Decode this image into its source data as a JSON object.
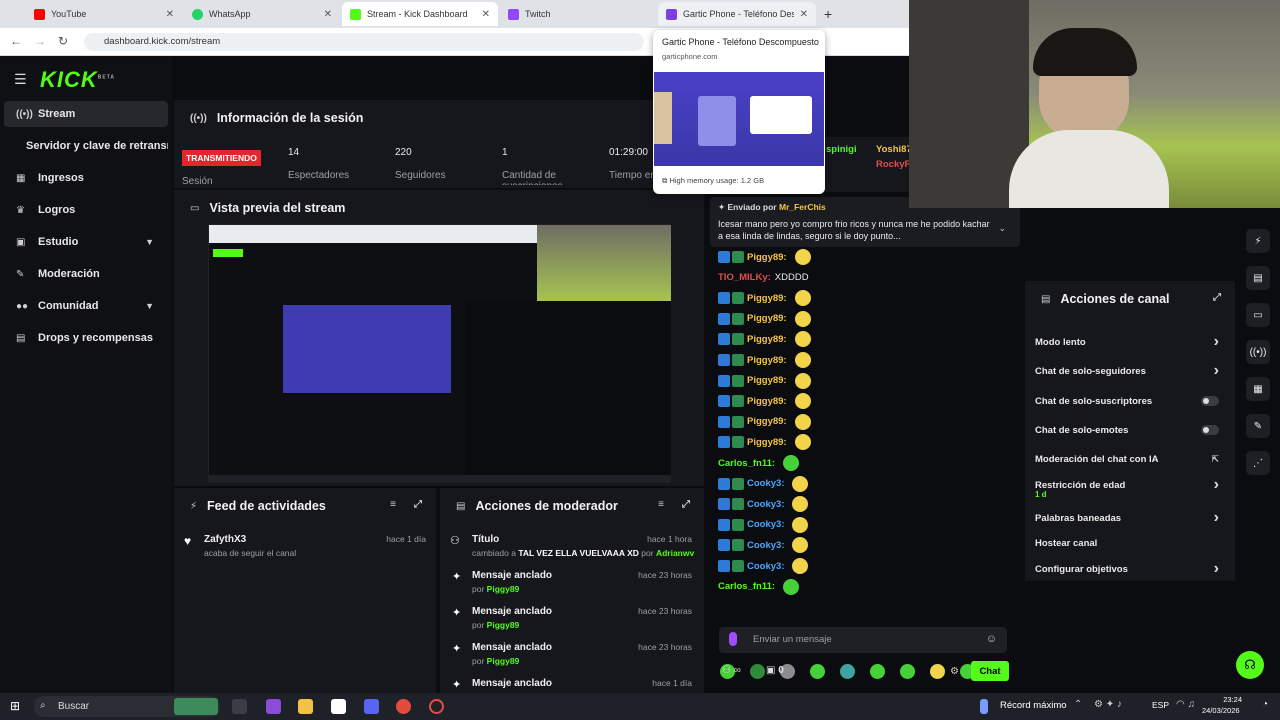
{
  "browser": {
    "tabs": [
      {
        "title": "YouTube",
        "color": "#ff0000"
      },
      {
        "title": "WhatsApp",
        "color": "#25d366"
      },
      {
        "title": "Stream - Kick Dashboard",
        "color": "#53fc18"
      },
      {
        "title": "Twitch",
        "color": "#9146ff"
      },
      {
        "title": "Gartic Phone - Teléfono Descon",
        "color": "#7b3fe4"
      }
    ],
    "url": "dashboard.kick.com/stream",
    "hover_card": {
      "title": "Gartic Phone - Teléfono Descompuesto",
      "domain": "garticphone.com",
      "memory": "High memory usage: 1.2 GB"
    }
  },
  "sidebar": {
    "logo": "KICK",
    "logo_sup": "BETA",
    "items": [
      {
        "label": "Stream",
        "icon": "broadcast-icon"
      },
      {
        "label": "Servidor y clave de retransmisión",
        "icon": ""
      },
      {
        "label": "Ingresos",
        "icon": "chart-icon"
      },
      {
        "label": "Logros",
        "icon": "trophy-icon"
      },
      {
        "label": "Estudio",
        "icon": "grid-icon"
      },
      {
        "label": "Moderación",
        "icon": "wrench-icon"
      },
      {
        "label": "Comunidad",
        "icon": "users-icon"
      },
      {
        "label": "Drops y recompensas",
        "icon": "gift-icon"
      }
    ]
  },
  "session": {
    "title": "Información de la sesión",
    "status_badge": "TRANSMITIENDO",
    "status_label": "Sesión",
    "stats": [
      {
        "value": "14",
        "label": "Espectadores"
      },
      {
        "value": "220",
        "label": "Seguidores"
      },
      {
        "value": "1",
        "label": "Cantidad de suscripciones"
      },
      {
        "value": "01:29:00",
        "label": "Tiempo en vivo"
      }
    ]
  },
  "preview": {
    "title": "Vista previa del stream"
  },
  "feed": {
    "title": "Feed de actividades",
    "items": [
      {
        "name": "ZafythX3",
        "action": "acaba de seguir el canal",
        "time": "hace 1 día"
      }
    ]
  },
  "mod_actions": {
    "title": "Acciones de moderador",
    "items": [
      {
        "title": "Título",
        "detail_prefix": "cambiado a",
        "detail": "TAL VEZ ELLA VUELVAAA XD",
        "by_prefix": "por",
        "by": "Adrianwv",
        "time": "hace 1 hora"
      },
      {
        "title": "Mensaje anclado",
        "detail_prefix": "por",
        "detail": "Piggy89",
        "time": "hace 23 horas"
      },
      {
        "title": "Mensaje anclado",
        "detail_prefix": "por",
        "detail": "Piggy89",
        "time": "hace 23 horas"
      },
      {
        "title": "Mensaje anclado",
        "detail_prefix": "por",
        "detail": "Piggy89",
        "time": "hace 23 horas"
      },
      {
        "title": "Mensaje anclado",
        "detail_prefix": "",
        "detail": "",
        "time": "hace 1 día"
      }
    ]
  },
  "chat": {
    "top_users": [
      "spinigi",
      "Yoshi87",
      "RockyF"
    ],
    "pinned": {
      "label": "Enviado por",
      "user": "Mr_FerChis",
      "text": "Icesar mano pero yo compro frio ricos y nunca me he podido kachar a esa linda de lindas, seguro si le doy punto..."
    },
    "messages": [
      {
        "user": "Piggy89:",
        "text": "",
        "color": "#f5c542",
        "emote": "y"
      },
      {
        "user": "TIO_MILKy:",
        "text": "XDDDD",
        "color": "#e24d4d",
        "emote": ""
      },
      {
        "user": "Piggy89:",
        "text": "",
        "color": "#f5c542",
        "emote": "y"
      },
      {
        "user": "Piggy89:",
        "text": "",
        "color": "#f5c542",
        "emote": "y"
      },
      {
        "user": "Piggy89:",
        "text": "",
        "color": "#f5c542",
        "emote": "y"
      },
      {
        "user": "Piggy89:",
        "text": "",
        "color": "#f5c542",
        "emote": "y"
      },
      {
        "user": "Piggy89:",
        "text": "",
        "color": "#f5c542",
        "emote": "y"
      },
      {
        "user": "Piggy89:",
        "text": "",
        "color": "#f5c542",
        "emote": "y"
      },
      {
        "user": "Piggy89:",
        "text": "",
        "color": "#f5c542",
        "emote": "y"
      },
      {
        "user": "Piggy89:",
        "text": "",
        "color": "#f5c542",
        "emote": "y"
      },
      {
        "user": "Carlos_fn11:",
        "text": "",
        "color": "#53fc18",
        "emote": "g"
      },
      {
        "user": "Cooky3:",
        "text": "",
        "color": "#4aa8ff",
        "emote": "y"
      },
      {
        "user": "Cooky3:",
        "text": "",
        "color": "#4aa8ff",
        "emote": "y"
      },
      {
        "user": "Cooky3:",
        "text": "",
        "color": "#4aa8ff",
        "emote": "y"
      },
      {
        "user": "Cooky3:",
        "text": "",
        "color": "#4aa8ff",
        "emote": "y"
      },
      {
        "user": "Cooky3:",
        "text": "",
        "color": "#4aa8ff",
        "emote": "y"
      },
      {
        "user": "Carlos_fn11:",
        "text": "",
        "color": "#53fc18",
        "emote": "g"
      }
    ],
    "input_placeholder": "Enviar un mensaje",
    "viewers_icon": "∞",
    "gift_count": "0",
    "send_label": "Chat"
  },
  "channel_actions": {
    "title": "Acciones de canal",
    "items": [
      {
        "label": "Modo lento",
        "control": "chevron",
        "sub": ""
      },
      {
        "label": "Chat de solo-seguidores",
        "control": "chevron",
        "sub": ""
      },
      {
        "label": "Chat de solo-suscriptores",
        "control": "toggle",
        "sub": ""
      },
      {
        "label": "Chat de solo-emotes",
        "control": "toggle",
        "sub": ""
      },
      {
        "label": "Moderación del chat con IA",
        "control": "external",
        "sub": ""
      },
      {
        "label": "Restricción de edad",
        "control": "chevron",
        "sub": "1 d"
      },
      {
        "label": "Palabras baneadas",
        "control": "chevron",
        "sub": ""
      },
      {
        "label": "Hostear canal",
        "control": "",
        "sub": ""
      },
      {
        "label": "Configurar objetivos",
        "control": "chevron",
        "sub": ""
      }
    ]
  },
  "taskbar": {
    "search": "Buscar",
    "tray_text": "Récord máximo",
    "lang": "ESP",
    "time": "23:24",
    "date": "24/03/2026"
  }
}
